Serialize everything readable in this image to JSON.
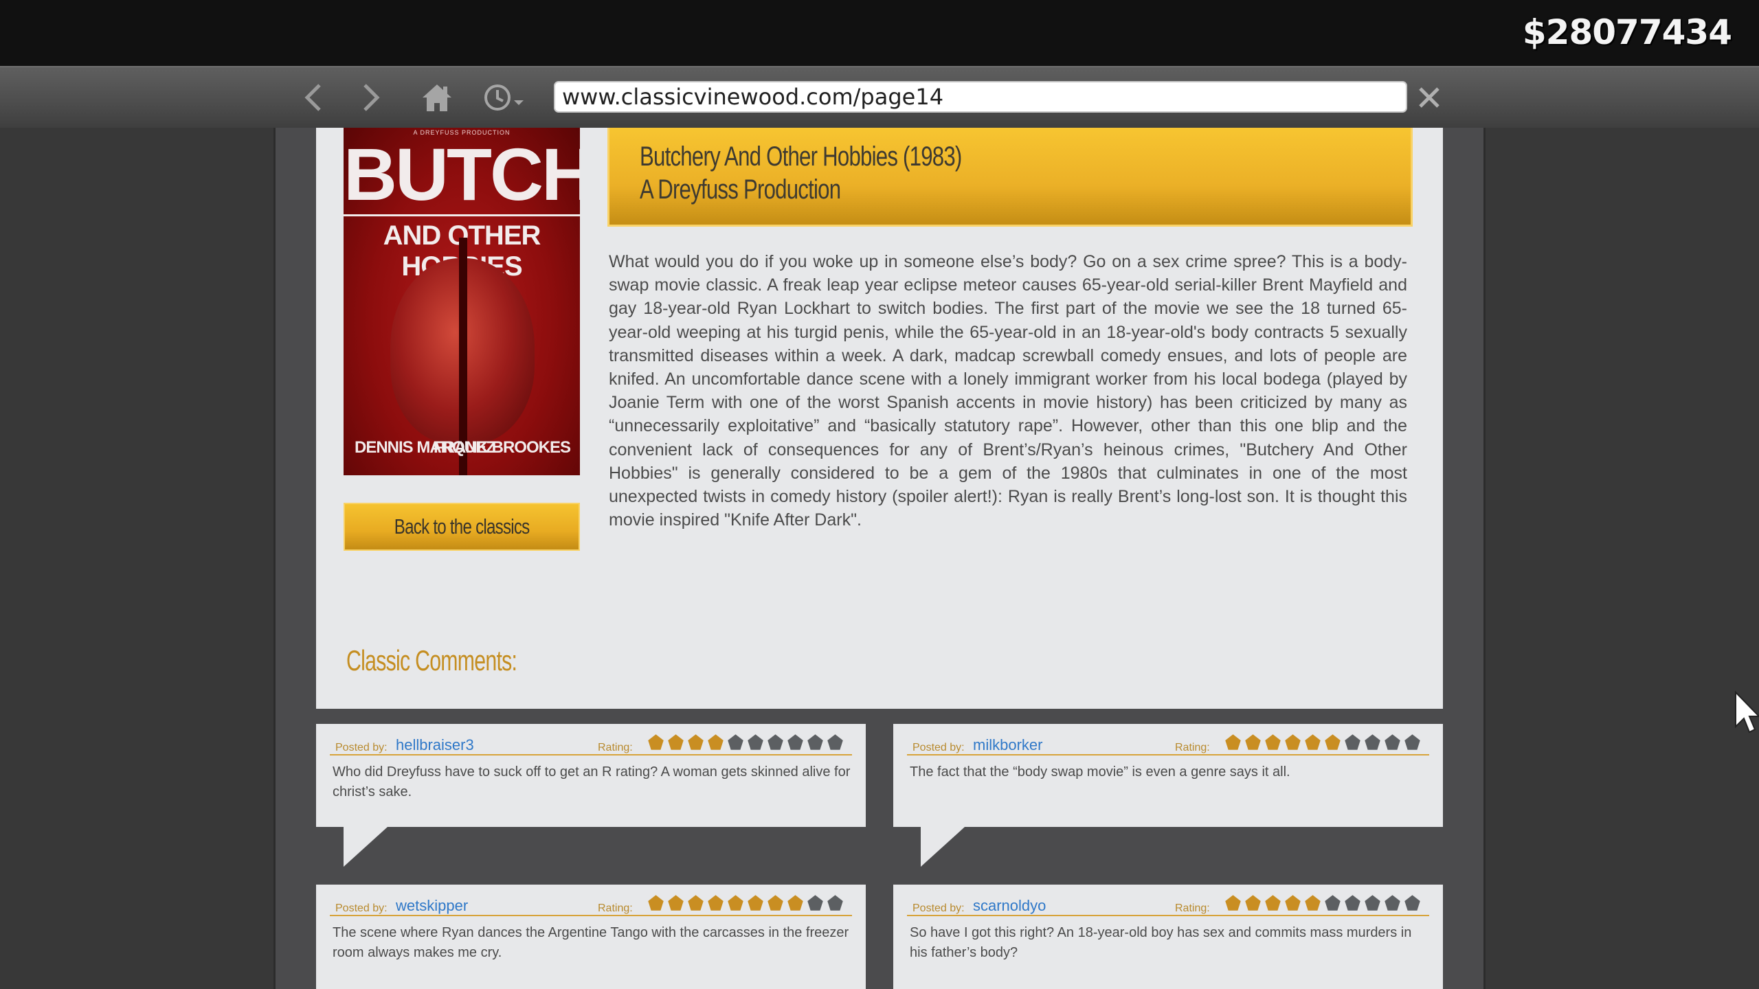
{
  "hud": {
    "money": "$28077434"
  },
  "browser": {
    "url": "www.classicvinewood.com/page14",
    "icons": [
      "back-arrow-icon",
      "forward-arrow-icon",
      "home-icon",
      "history-clock-icon",
      "close-icon"
    ]
  },
  "poster": {
    "tagline": "A DREYFUSS PRODUCTION",
    "title": "BUTCHERY",
    "subtitle": "AND OTHER HOBBIES",
    "actor_left": "DENNIS MARQUEZ",
    "actor_right": "FRANK BROOKES"
  },
  "movie": {
    "title": "Butchery And Other Hobbies (1983)",
    "studio": "A Dreyfuss Production",
    "description": "What would you do if you woke up in someone else’s body?  Go on a sex crime spree?  This is a body-swap movie classic. A freak leap year eclipse meteor causes 65-year-old serial-killer Brent Mayfield and gay 18-year-old Ryan Lockhart to switch bodies. The first part of the movie we see the 18 turned 65-year-old weeping at his turgid penis, while the 65-year-old in an 18-year-old's body contracts 5 sexually transmitted diseases within a week. A dark, madcap screwball comedy ensues, and lots of people are knifed. An uncomfortable dance scene with a lonely immigrant worker from his local bodega (played by Joanie Term with one of the worst Spanish accents in movie history) has been criticized by many as “unnecessarily exploitative” and “basically statutory rape”. However, other than this one blip and the convenient lack of consequences for any of Brent’s/Ryan’s heinous crimes, \"Butchery And Other Hobbies\" is generally considered to be a gem of the 1980s that culminates in one of the most unexpected twists in comedy history (spoiler alert!): Ryan is really Brent’s long-lost son. It is thought this movie inspired \"Knife After Dark\"."
  },
  "back_button": {
    "label": "Back to the classics"
  },
  "comments_heading": "Classic Comments:",
  "comments": [
    {
      "posted_by_label": "Posted by:",
      "user": "hellbraiser3",
      "rating_label": "Rating:",
      "rating": 4,
      "max": 10,
      "text": "Who did Dreyfuss have to suck off to get an R rating?  A woman gets skinned alive for christ’s sake."
    },
    {
      "posted_by_label": "Posted by:",
      "user": "milkborker",
      "rating_label": "Rating:",
      "rating": 6,
      "max": 10,
      "text": "The fact that the “body swap movie” is even a genre says it all."
    },
    {
      "posted_by_label": "Posted by:",
      "user": "wetskipper",
      "rating_label": "Rating:",
      "rating": 8,
      "max": 10,
      "text": "The scene where Ryan dances the Argentine Tango with the carcasses in the freezer room always makes me cry."
    },
    {
      "posted_by_label": "Posted by:",
      "user": "scarnoldyo",
      "rating_label": "Rating:",
      "rating": 5,
      "max": 10,
      "text": "So have I got this right?  An 18-year-old boy has sex and commits mass murders in his father’s body?"
    }
  ],
  "colors": {
    "accent_gold": "#f2bd2e",
    "star_on": "#c98e22",
    "star_off": "#5c5f62",
    "link_blue": "#2f78c8"
  }
}
